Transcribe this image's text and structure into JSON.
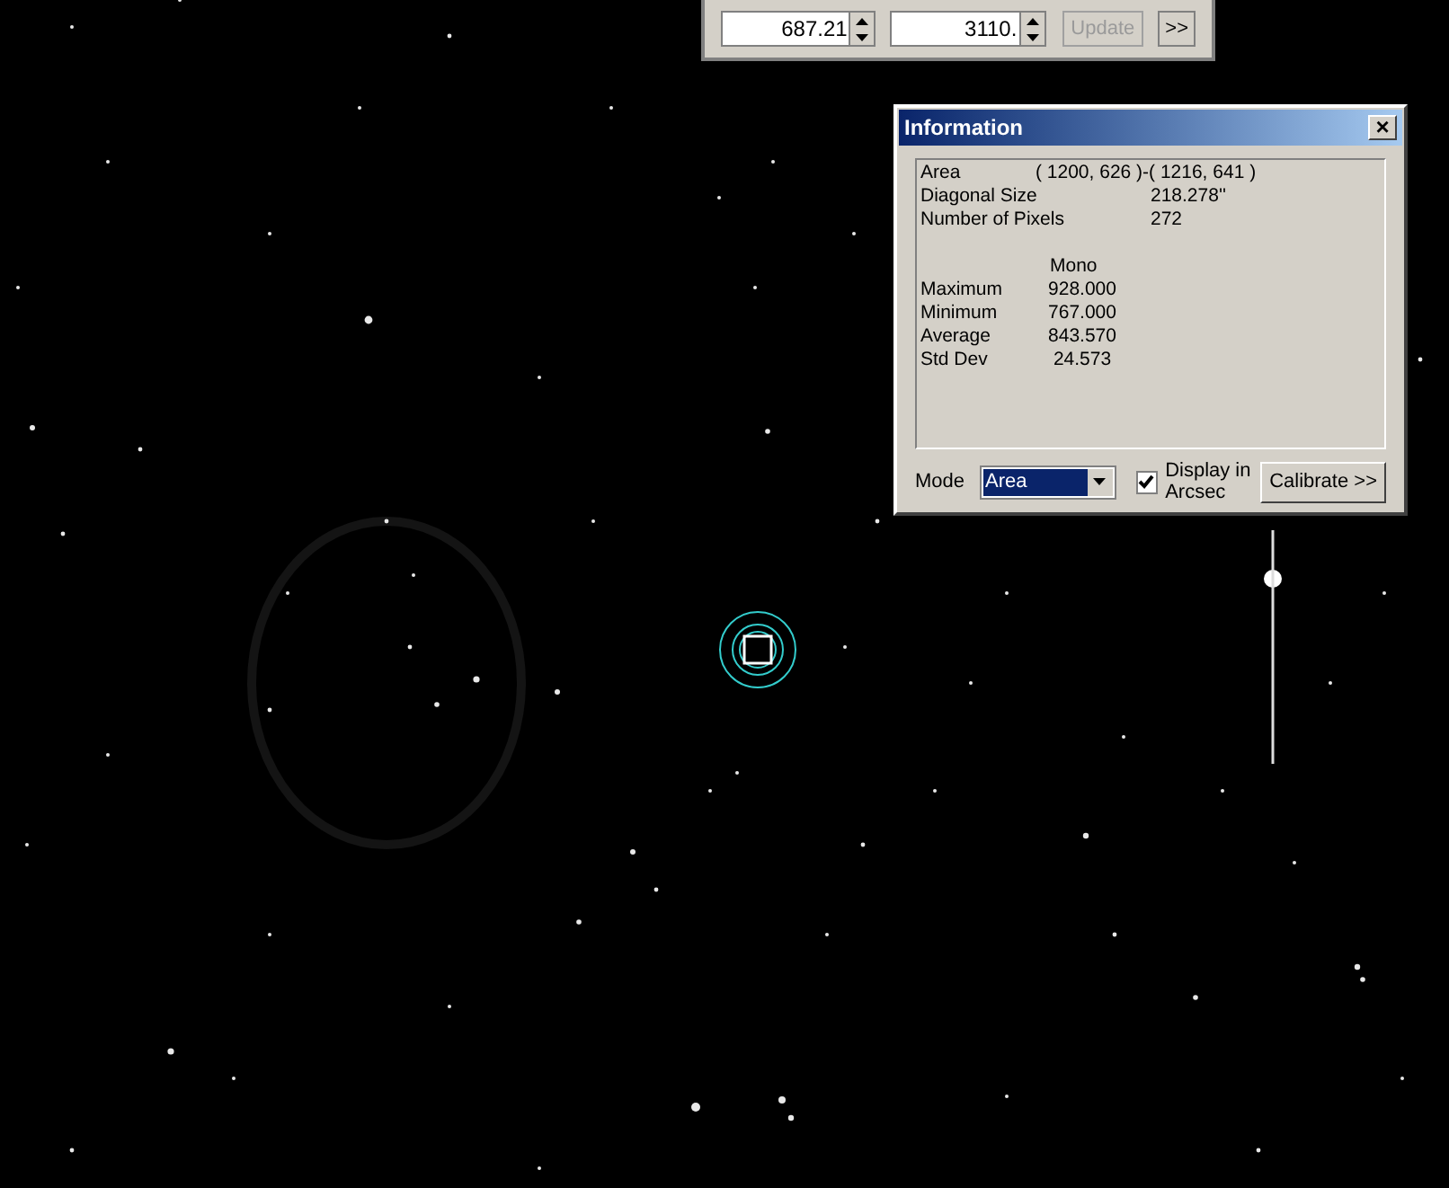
{
  "toolbar": {
    "minimum_value": "687.21",
    "maximum_value": "3110.",
    "update_button": {
      "label": "Update",
      "disabled": true
    },
    "more_button": ">>"
  },
  "information": {
    "title": "Information",
    "close": "×",
    "rows": [
      {
        "label": "Area",
        "value": "( 1200, 626 )-( 1216, 641 )"
      },
      {
        "label": "Diagonal Size",
        "value": "218.278''"
      },
      {
        "label": "Number of Pixels",
        "value": "272"
      }
    ],
    "stats_header": "Mono",
    "stats": [
      {
        "label": "Maximum",
        "value": "928.000"
      },
      {
        "label": "Minimum",
        "value": "767.000"
      },
      {
        "label": "Average",
        "value": "843.570"
      },
      {
        "label": "Std Dev",
        "value": "24.573"
      }
    ],
    "mode_label": "Mode",
    "mode_value": "Area",
    "display_arcsec": {
      "label": "Display in Arcsec",
      "checked": true
    },
    "calibrate_button": "Calibrate >>"
  }
}
